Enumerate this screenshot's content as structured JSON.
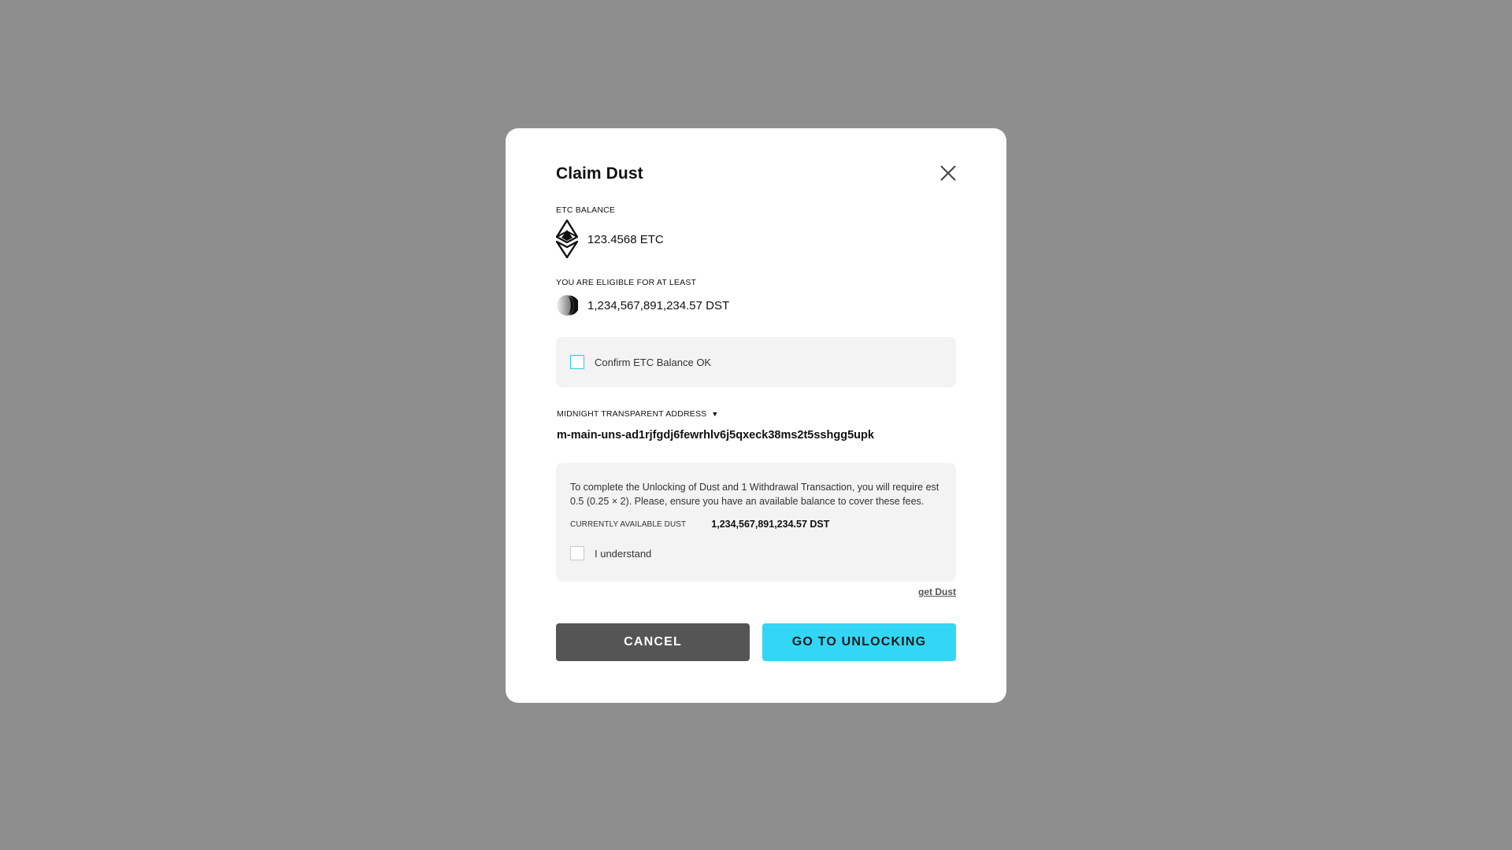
{
  "modal": {
    "title": "Claim Dust",
    "etc_label": "ETC BALANCE",
    "etc_amount": "123.4568 ETC",
    "eligible_label": "YOU ARE ELIGIBLE FOR AT LEAST",
    "dust_amount": "1,234,567,891,234.57 DST",
    "confirm_label": "Confirm ETC Balance OK",
    "address_label": "MIDNIGHT TRANSPARENT ADDRESS",
    "address_caret": "▼",
    "address_value": "m-main-uns-ad1rjfgdj6fewrhlv6j5qxeck38ms2t5sshgg5upk",
    "fee_notice": "To complete the Unlocking of Dust and 1 Withdrawal Transaction, you will require est 0.5 (0.25 × 2). Please, ensure you have an available balance to cover these fees.",
    "available_label": "CURRENTLY AVAILABLE DUST",
    "available_value": "1,234,567,891,234.57 DST",
    "understand_label": "I understand",
    "get_dust_link": "get Dust",
    "cancel_label": "CANCEL",
    "go_label": "GO TO UNLOCKING"
  },
  "icons": {
    "close": "close-icon",
    "etc": "ethereum-classic-icon",
    "dust": "dust-token-icon",
    "caret": "caret-down-icon"
  },
  "colors": {
    "backdrop": "#8e8e8e",
    "accent": "#33d6f5",
    "cancel": "#555555",
    "panel": "#f3f3f3"
  }
}
